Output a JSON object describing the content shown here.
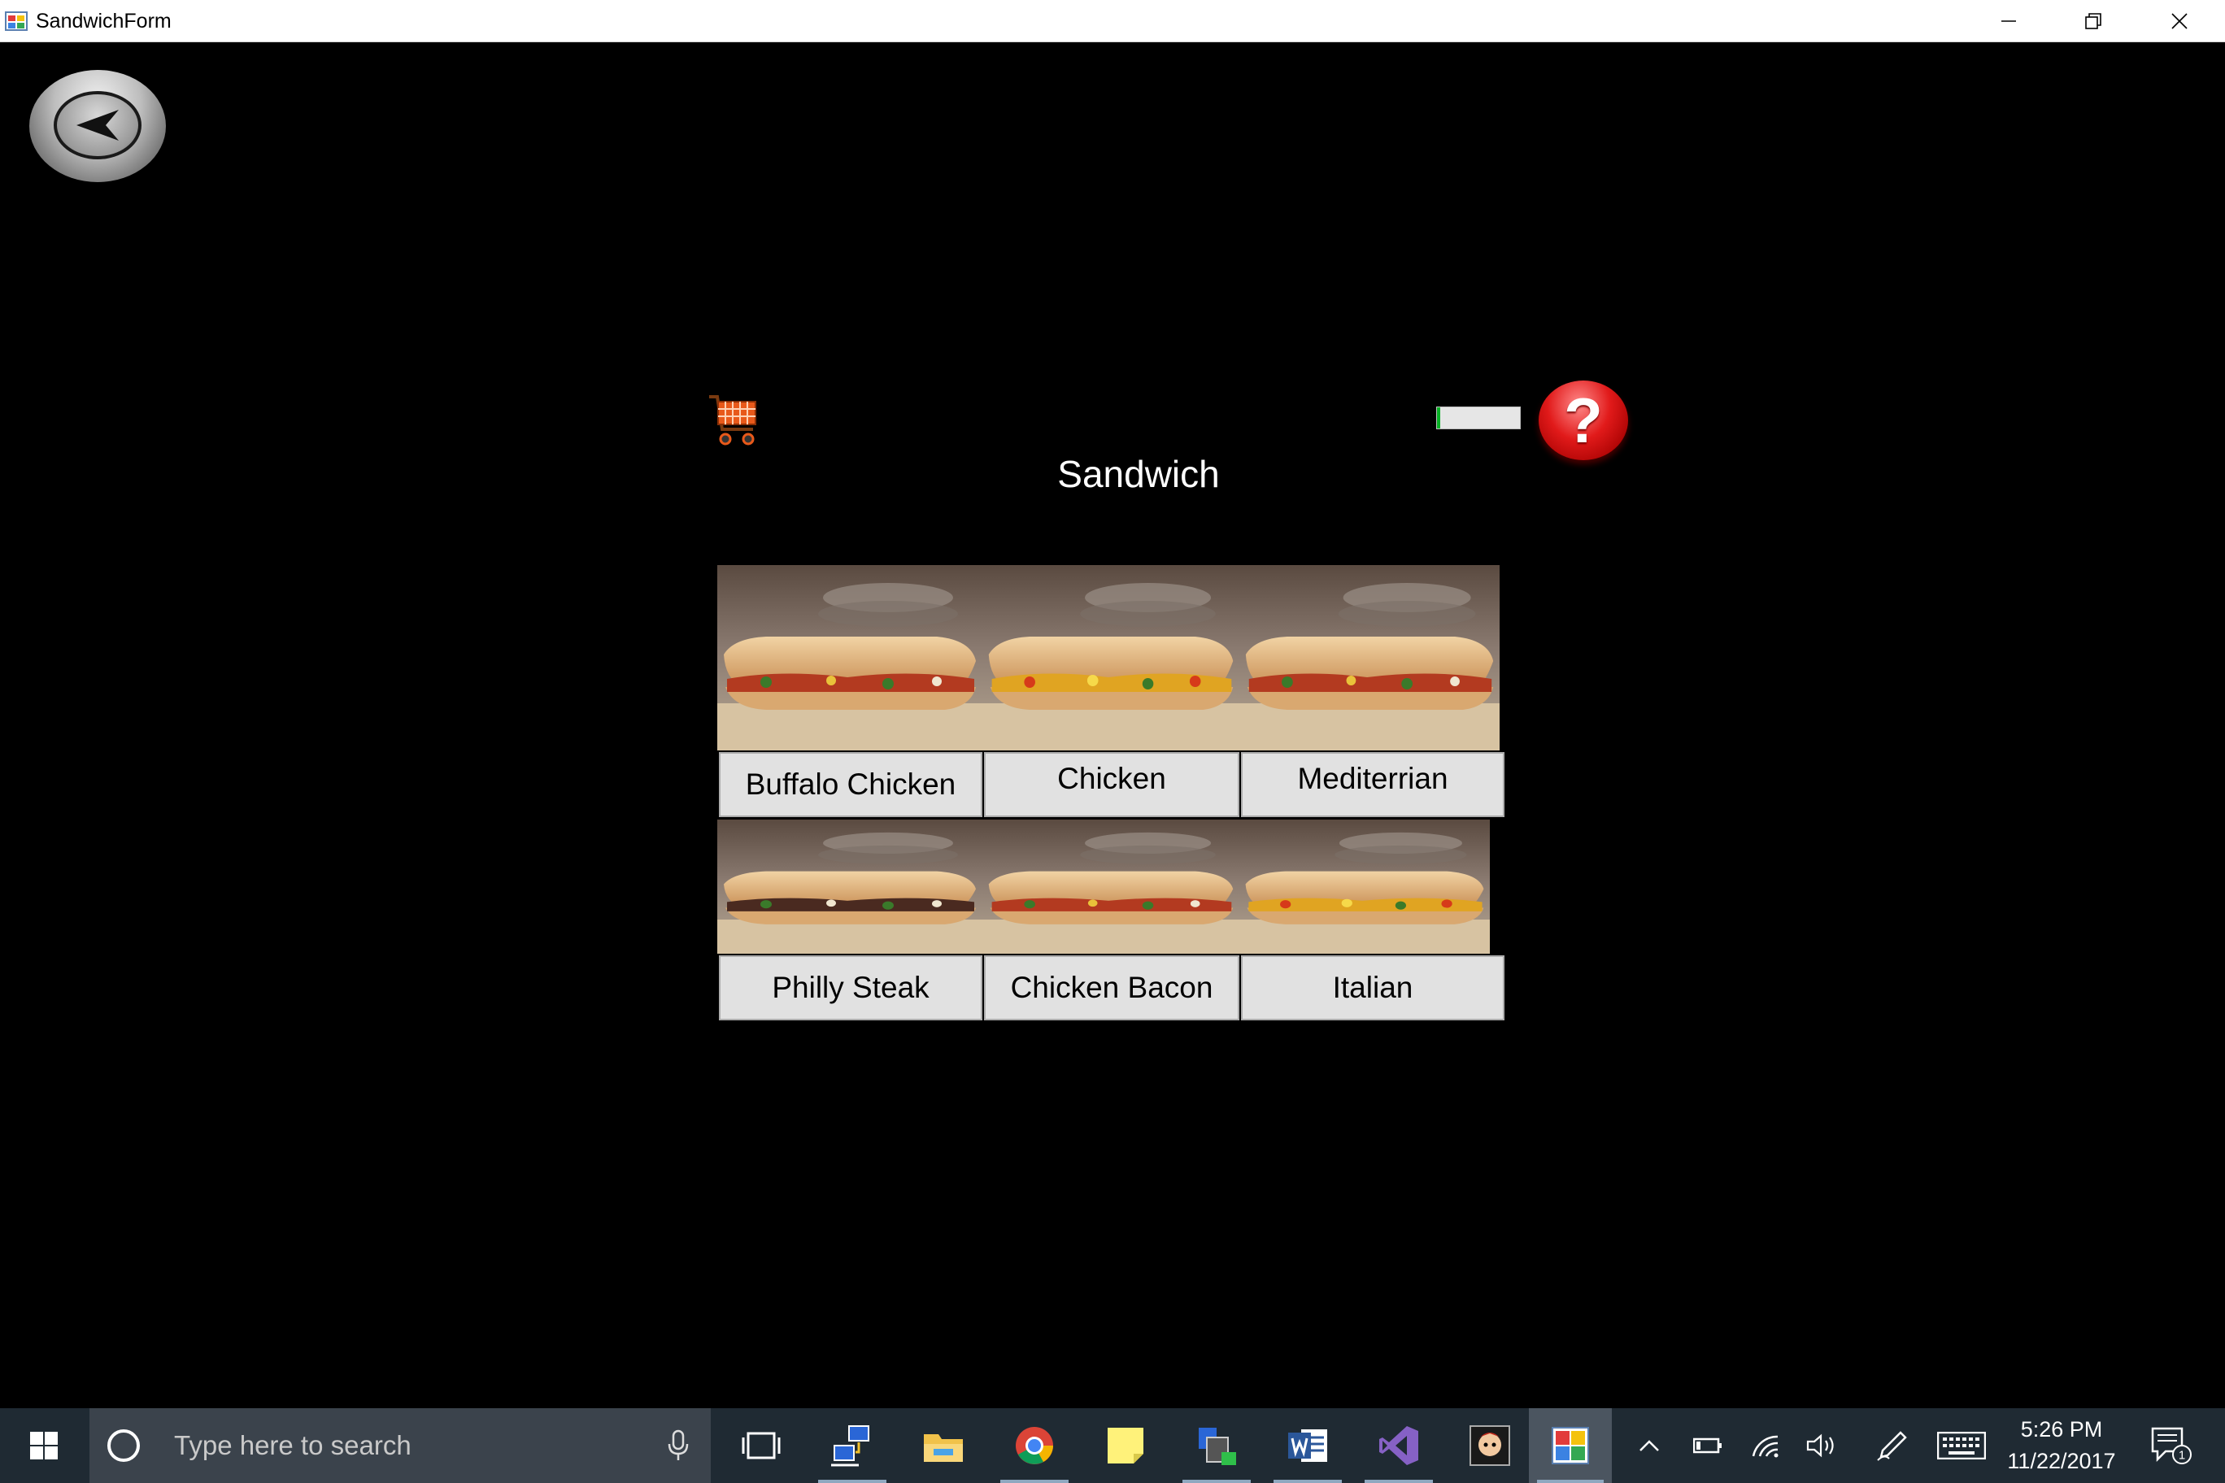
{
  "window": {
    "title": "SandwichForm"
  },
  "form": {
    "heading": "Sandwich",
    "progress_fraction": 0.04,
    "help_symbol": "?",
    "items": [
      {
        "label": "Buffalo Chicken",
        "icon": "sandwich-photo"
      },
      {
        "label": "Chicken",
        "icon": "sandwich-photo"
      },
      {
        "label": "Mediterrian",
        "icon": "sandwich-photo"
      },
      {
        "label": "Philly Steak",
        "icon": "sandwich-photo"
      },
      {
        "label": "Chicken Bacon",
        "icon": "sandwich-photo"
      },
      {
        "label": "Italian",
        "icon": "sandwich-photo"
      }
    ]
  },
  "taskbar": {
    "search_placeholder": "Type here to search",
    "time": "5:26 PM",
    "date": "11/22/2017",
    "notification_count": "1",
    "pinned_apps": [
      "task-view",
      "network-app",
      "file-explorer",
      "chrome",
      "sticky-notes",
      "store-app",
      "word",
      "visual-studio",
      "game-app",
      "sandwich-form-app"
    ]
  },
  "colors": {
    "background": "#000000",
    "progress_fill": "#06b025",
    "help_red": "#e11a1a",
    "label_button": "#e1e1e1",
    "taskbar": "#1f2a33"
  }
}
